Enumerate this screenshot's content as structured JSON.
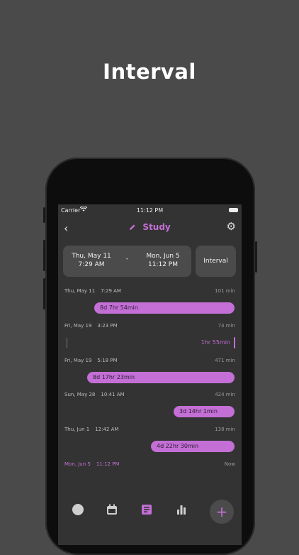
{
  "headline": "Interval",
  "status_bar": {
    "carrier": "Carrier",
    "time": "11:12 PM"
  },
  "nav": {
    "title": "Study"
  },
  "range": {
    "from_date": "Thu, May 11",
    "from_time": "7:29 AM",
    "separator": "-",
    "to_date": "Mon, Jun 5",
    "to_time": "11:12 PM",
    "mode": "Interval"
  },
  "timeline": [
    {
      "date": "Thu, May 11",
      "time": "7:29 AM",
      "minutes": "101 min",
      "interval": "8d 7hr 54min"
    },
    {
      "date": "Fri, May 19",
      "time": "3:23 PM",
      "minutes": "74 min",
      "interval": "1hr 55min"
    },
    {
      "date": "Fri, May 19",
      "time": "5:18 PM",
      "minutes": "471 min",
      "interval": "8d 17hr 23min"
    },
    {
      "date": "Sun, May 28",
      "time": "10:41 AM",
      "minutes": "424 min",
      "interval": "3d 14hr 1min"
    },
    {
      "date": "Thu, Jun 1",
      "time": "12:42 AM",
      "minutes": "138 min",
      "interval": "4d 22hr 30min"
    },
    {
      "date": "Mon, Jun 5",
      "time": "11:12 PM",
      "minutes": "Now"
    }
  ],
  "colors": {
    "accent": "#c36fd6",
    "background": "#333333",
    "card": "#4b4b4b"
  }
}
